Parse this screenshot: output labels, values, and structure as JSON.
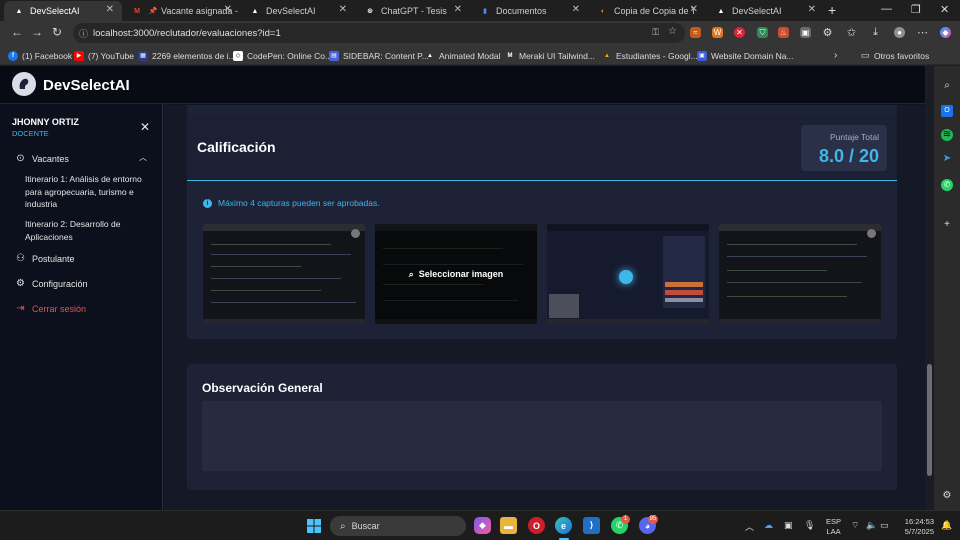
{
  "browser": {
    "tabs": [
      {
        "label": "DevSelectAI",
        "favicon_color": "#ffffff",
        "favicon_glyph": "▲",
        "active": true
      },
      {
        "label": "Vacante asignada -",
        "favicon_color": "#ea4335",
        "favicon_glyph": "M"
      },
      {
        "label": "DevSelectAI",
        "favicon_color": "#ffffff",
        "favicon_glyph": "▲"
      },
      {
        "label": "DevSelectAI",
        "favicon_color": "#e04a3f",
        "favicon_glyph": "◉"
      },
      {
        "label": "ChatGPT - Tesis",
        "favicon_color": "#ffffff",
        "favicon_glyph": "⊛"
      },
      {
        "label": "Documentos",
        "favicon_color": "#4c8bf5",
        "favicon_glyph": "▮"
      },
      {
        "label": "Copia de Copia de TESIS",
        "favicon_color": "#f08a24",
        "favicon_glyph": "◐"
      },
      {
        "label": "DevSelectAI",
        "favicon_color": "#ffffff",
        "favicon_glyph": "▲"
      }
    ],
    "new_tab": "+",
    "window_controls": {
      "minimize": "—",
      "maximize": "❐",
      "close": "✕"
    },
    "url": "localhost:3000/reclutador/evaluaciones?id=1",
    "bookmarks": [
      {
        "label": "(1) Facebook",
        "color": "#1877f2",
        "glyph": "f"
      },
      {
        "label": "(7) YouTube",
        "color": "#ff0000",
        "glyph": "▶"
      },
      {
        "label": "2269 elementos de i...",
        "color": "#2d3b8f",
        "glyph": "▦"
      },
      {
        "label": "CodePen: Online Co...",
        "color": "#ffffff",
        "glyph": "◇"
      },
      {
        "label": "SIDEBAR: Content P...",
        "color": "#4a63d9",
        "glyph": "▤"
      },
      {
        "label": "Animated Modal",
        "color": "#ffffff",
        "glyph": "▲"
      },
      {
        "label": "Meraki UI Tailwind...",
        "color": "#ffffff",
        "glyph": "M"
      },
      {
        "label": "Estudiantes - Googl...",
        "color": "#f4b400",
        "glyph": "▲"
      },
      {
        "label": "Website Domain Na...",
        "color": "#3b5bdb",
        "glyph": "▣"
      }
    ],
    "bookmarks_other": "Otros favoritos"
  },
  "app": {
    "brand": "DevSelectAI",
    "user": {
      "name": "JHONNY ORTIZ",
      "role": "DOCENTE"
    },
    "nav": {
      "vacantes": "Vacantes",
      "vacantes_items": [
        "Itinerario 1: Análisis de entorno para agropecuaria, turismo e industria",
        "Itinerario 2: Desarrollo de Aplicaciones"
      ],
      "postulante": "Postulante",
      "configuracion": "Configuración",
      "cerrar_sesion": "Cerrar sesión"
    },
    "calificacion": {
      "title": "Calificación",
      "score_label": "Puntaje Total",
      "score_value": "8.0 / 20",
      "info": "Máximo 4 capturas pueden ser aprobadas.",
      "select_image": "Seleccionar imagen",
      "screenshot_count": 4
    },
    "observacion": {
      "title": "Observación General",
      "value": ""
    },
    "colors": {
      "accent": "#3fb7e8",
      "danger": "#e5534b",
      "sidebar_bg": "#0c0f1c",
      "card_bg": "#1d2237"
    }
  },
  "taskbar": {
    "search": "Buscar",
    "lang_1": "ESP",
    "lang_2": "LAA",
    "time": "16:24:53",
    "date": "5/7/2025",
    "whatsapp_badge": "1",
    "discord_badge": "95"
  }
}
